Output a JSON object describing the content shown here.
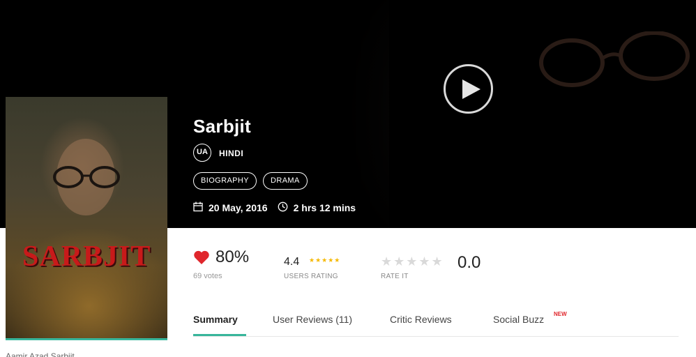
{
  "movie": {
    "title": "Sarbjit",
    "certificate": "UA",
    "language": "HINDI",
    "genres": [
      "BIOGRAPHY",
      "DRAMA"
    ],
    "release_date": "20 May, 2016",
    "duration": "2 hrs 12 mins"
  },
  "poster": {
    "title_text": "SARBJIT"
  },
  "below_poster_text": "Aamir Azad Sarbjit",
  "ratings": {
    "like_percent": "80%",
    "votes": "69 votes",
    "users_rating_value": "4.4",
    "users_rating_stars": "★★★★★",
    "users_rating_label": "USERS RATING",
    "rate_it_stars": "★★★★★",
    "rate_it_label": "RATE IT",
    "rate_it_value": "0.0"
  },
  "tabs": [
    {
      "label": "Summary",
      "active": true
    },
    {
      "label": "User Reviews (11)",
      "active": false
    },
    {
      "label": "Critic Reviews",
      "active": false
    },
    {
      "label": "Social Buzz",
      "active": false
    }
  ],
  "new_badge": "NEW",
  "colors": {
    "accent": "#37b59b",
    "heart": "#e0262c",
    "star": "#f5b800"
  }
}
